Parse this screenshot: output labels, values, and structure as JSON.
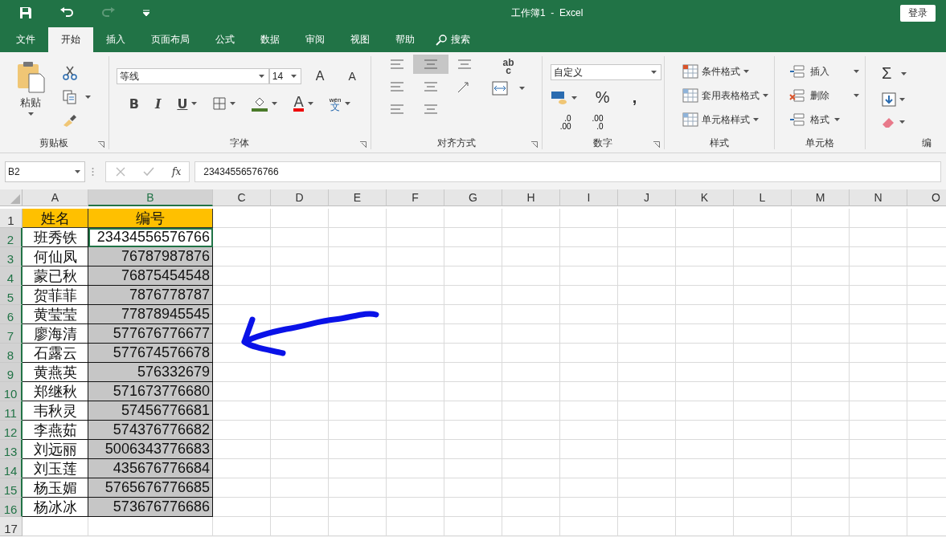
{
  "window": {
    "title": "工作簿1  -  Excel",
    "sign_in": "登录"
  },
  "tabs": [
    {
      "label": "文件",
      "selected": false
    },
    {
      "label": "开始",
      "selected": true
    },
    {
      "label": "插入",
      "selected": false
    },
    {
      "label": "页面布局",
      "selected": false
    },
    {
      "label": "公式",
      "selected": false
    },
    {
      "label": "数据",
      "selected": false
    },
    {
      "label": "审阅",
      "selected": false
    },
    {
      "label": "视图",
      "selected": false
    },
    {
      "label": "帮助",
      "selected": false
    }
  ],
  "search": {
    "label": "搜索"
  },
  "ribbon": {
    "clipboard": {
      "paste": "粘贴",
      "group": "剪贴板"
    },
    "font": {
      "family": "等线",
      "size": "14",
      "grow": "A",
      "shrink": "A",
      "bold": "B",
      "italic": "I",
      "underline": "U",
      "font_color": "A",
      "phonetic_top": "wén",
      "phonetic_bottom": "文",
      "group": "字体"
    },
    "alignment": {
      "wrap_top": "ab",
      "wrap_bottom": "c",
      "group": "对齐方式"
    },
    "number": {
      "format": "自定义",
      "percent": "%",
      "comma": ",",
      "increase_decimal": [
        ".0",
        ".00"
      ],
      "decrease_decimal": [
        ".00",
        ".0"
      ],
      "group": "数字"
    },
    "styles": {
      "items": [
        "条件格式",
        "套用表格格式",
        "单元格样式"
      ],
      "group": "样式"
    },
    "cells": {
      "items": [
        "插入",
        "删除",
        "格式"
      ],
      "group": "单元格"
    },
    "editing": {
      "sum": "Σ",
      "group": "编"
    }
  },
  "formula_bar": {
    "name_box": "B2",
    "fx": "fx",
    "value": "23434556576766"
  },
  "sheet": {
    "columns": [
      {
        "label": "A",
        "selected": false
      },
      {
        "label": "B",
        "selected": true
      },
      {
        "label": "C",
        "selected": false
      },
      {
        "label": "D",
        "selected": false
      },
      {
        "label": "E",
        "selected": false
      },
      {
        "label": "F",
        "selected": false
      },
      {
        "label": "G",
        "selected": false
      },
      {
        "label": "H",
        "selected": false
      },
      {
        "label": "I",
        "selected": false
      },
      {
        "label": "J",
        "selected": false
      },
      {
        "label": "K",
        "selected": false
      },
      {
        "label": "L",
        "selected": false
      },
      {
        "label": "M",
        "selected": false
      },
      {
        "label": "N",
        "selected": false
      },
      {
        "label": "O",
        "selected": false
      }
    ],
    "rows": [
      {
        "label": "1",
        "kind": "header",
        "selected": false,
        "cells": [
          {
            "text": "姓名",
            "selected": false
          },
          {
            "text": "编号",
            "selected": false
          }
        ]
      },
      {
        "label": "2",
        "kind": "data",
        "selected": true,
        "cells": [
          {
            "text": "班秀铁",
            "selected": false
          },
          {
            "text": "23434556576766",
            "selected": false,
            "active": true
          }
        ]
      },
      {
        "label": "3",
        "kind": "data",
        "selected": true,
        "cells": [
          {
            "text": "何仙凤",
            "selected": false
          },
          {
            "text": "76787987876",
            "selected": true
          }
        ]
      },
      {
        "label": "4",
        "kind": "data",
        "selected": true,
        "cells": [
          {
            "text": "蒙已秋",
            "selected": false
          },
          {
            "text": "76875454548",
            "selected": true
          }
        ]
      },
      {
        "label": "5",
        "kind": "data",
        "selected": true,
        "cells": [
          {
            "text": "贺菲菲",
            "selected": false
          },
          {
            "text": "7876778787",
            "selected": true
          }
        ]
      },
      {
        "label": "6",
        "kind": "data",
        "selected": true,
        "cells": [
          {
            "text": "黄莹莹",
            "selected": false
          },
          {
            "text": "77878945545",
            "selected": true
          }
        ]
      },
      {
        "label": "7",
        "kind": "data",
        "selected": true,
        "cells": [
          {
            "text": "廖海清",
            "selected": false
          },
          {
            "text": "577676776677",
            "selected": true
          }
        ]
      },
      {
        "label": "8",
        "kind": "data",
        "selected": true,
        "cells": [
          {
            "text": "石露云",
            "selected": false
          },
          {
            "text": "577674576678",
            "selected": true
          }
        ]
      },
      {
        "label": "9",
        "kind": "data",
        "selected": true,
        "cells": [
          {
            "text": "黄燕英",
            "selected": false
          },
          {
            "text": "576332679",
            "selected": true
          }
        ]
      },
      {
        "label": "10",
        "kind": "data",
        "selected": true,
        "cells": [
          {
            "text": "郑继秋",
            "selected": false
          },
          {
            "text": "571673776680",
            "selected": true
          }
        ]
      },
      {
        "label": "11",
        "kind": "data",
        "selected": true,
        "cells": [
          {
            "text": "韦秋灵",
            "selected": false
          },
          {
            "text": "57456776681",
            "selected": true
          }
        ]
      },
      {
        "label": "12",
        "kind": "data",
        "selected": true,
        "cells": [
          {
            "text": "李燕茹",
            "selected": false
          },
          {
            "text": "574376776682",
            "selected": true
          }
        ]
      },
      {
        "label": "13",
        "kind": "data",
        "selected": true,
        "cells": [
          {
            "text": "刘远丽",
            "selected": false
          },
          {
            "text": "5006343776683",
            "selected": true
          }
        ]
      },
      {
        "label": "14",
        "kind": "data",
        "selected": true,
        "cells": [
          {
            "text": "刘玉莲",
            "selected": false
          },
          {
            "text": "435676776684",
            "selected": true
          }
        ]
      },
      {
        "label": "15",
        "kind": "data",
        "selected": true,
        "cells": [
          {
            "text": "杨玉媚",
            "selected": false
          },
          {
            "text": "5765676776685",
            "selected": true
          }
        ]
      },
      {
        "label": "16",
        "kind": "data",
        "selected": true,
        "cells": [
          {
            "text": "杨冰冰",
            "selected": false
          },
          {
            "text": "573676776686",
            "selected": true
          }
        ]
      },
      {
        "label": "17",
        "kind": "empty",
        "selected": false,
        "cells": []
      }
    ]
  }
}
